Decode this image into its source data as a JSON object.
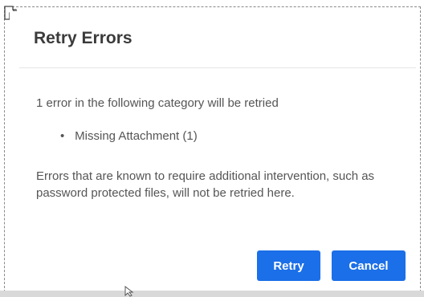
{
  "dialog": {
    "title": "Retry Errors",
    "summary": "1 error in the following category will be retried",
    "categories": [
      {
        "bullet": "•",
        "label": "Missing Attachment (1)"
      }
    ],
    "note": "Errors that are known to require additional intervention, such as password protected files, will not be retried here.",
    "buttons": {
      "retry": "Retry",
      "cancel": "Cancel"
    }
  },
  "colors": {
    "primary_button": "#1b6fe8",
    "text": "#555555",
    "title": "#3b3b3b"
  }
}
